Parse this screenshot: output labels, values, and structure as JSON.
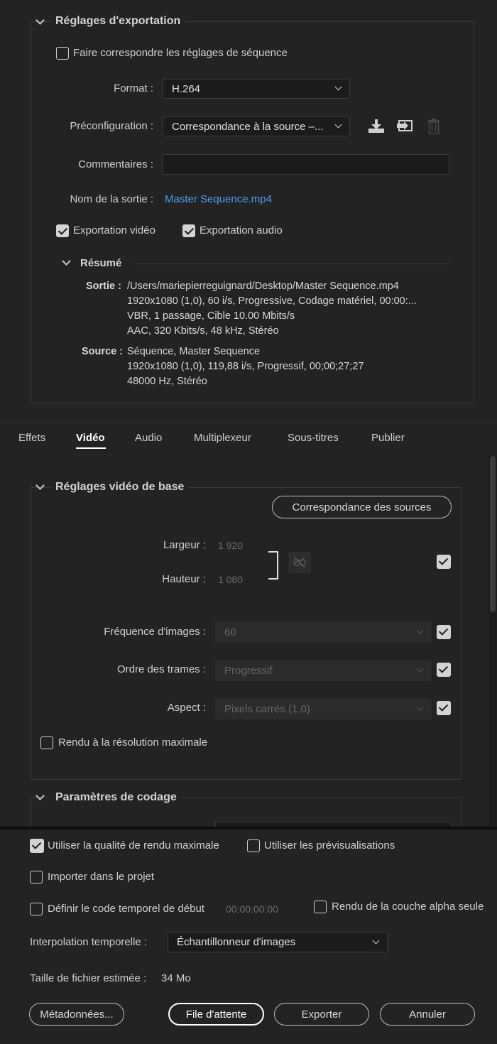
{
  "export_settings": {
    "title": "Réglages d'exportation",
    "match_sequence_label": "Faire correspondre les réglages de séquence",
    "format_label": "Format :",
    "format_value": "H.264",
    "preset_label": "Préconfiguration :",
    "preset_value": "Correspondance à la source –...",
    "comments_label": "Commentaires :",
    "comments_value": "",
    "output_name_label": "Nom de la sortie :",
    "output_name_value": "Master Sequence.mp4",
    "export_video_label": "Exportation vidéo",
    "export_audio_label": "Exportation audio",
    "summary": {
      "title": "Résumé",
      "output_label": "Sortie :",
      "output_lines": [
        "/Users/mariepierreguignard/Desktop/Master Sequence.mp4",
        "1920x1080 (1,0), 60 i/s, Progressive, Codage matériel, 00:00:...",
        "VBR, 1 passage, Cible 10.00  Mbits/s",
        "AAC, 320  Kbits/s, 48  kHz, Stéréo"
      ],
      "source_label": "Source :",
      "source_lines": [
        "Séquence, Master Sequence",
        "1920x1080 (1,0), 119,88  i/s, Progressif, 00;00;27;27",
        "48000 Hz, Stéréo"
      ]
    }
  },
  "tabs": [
    "Effets",
    "Vidéo",
    "Audio",
    "Multiplexeur",
    "Sous-titres",
    "Publier"
  ],
  "active_tab": "Vidéo",
  "video_basic": {
    "title": "Réglages vidéo de base",
    "match_sources_button": "Correspondance des sources",
    "width_label": "Largeur :",
    "width_value": "1 920",
    "height_label": "Hauteur :",
    "height_value": "1 080",
    "frame_rate_label": "Fréquence d'images :",
    "frame_rate_value": "60",
    "field_order_label": "Ordre des trames :",
    "field_order_value": "Progressif",
    "aspect_label": "Aspect :",
    "aspect_value": "Pixels carrés (1,0)",
    "max_render_label": "Rendu à la résolution maximale"
  },
  "encoding": {
    "title": "Paramètres de codage"
  },
  "bottom": {
    "max_quality_label": "Utiliser la qualité de rendu maximale",
    "use_previews_label": "Utiliser les prévisualisations",
    "import_label": "Importer dans le projet",
    "start_timecode_label": "Définir le code temporel de début",
    "start_timecode_value": "00:00:00:00",
    "alpha_label": "Rendu de la couche alpha seule",
    "interp_label": "Interpolation temporelle :",
    "interp_value": "Échantillonneur d'images",
    "filesize_label": "Taille de fichier estimée :",
    "filesize_value": "34 Mo",
    "metadata_button": "Métadonnées...",
    "queue_button": "File d'attente",
    "export_button": "Exporter",
    "cancel_button": "Annuler"
  },
  "icons": [
    "chevron-down-icon",
    "save-preset-icon",
    "import-preset-icon",
    "trash-icon",
    "link-icon"
  ],
  "colors": {
    "background": "#232323",
    "link": "#4d9ff0",
    "primary_border": "#ffffff"
  }
}
